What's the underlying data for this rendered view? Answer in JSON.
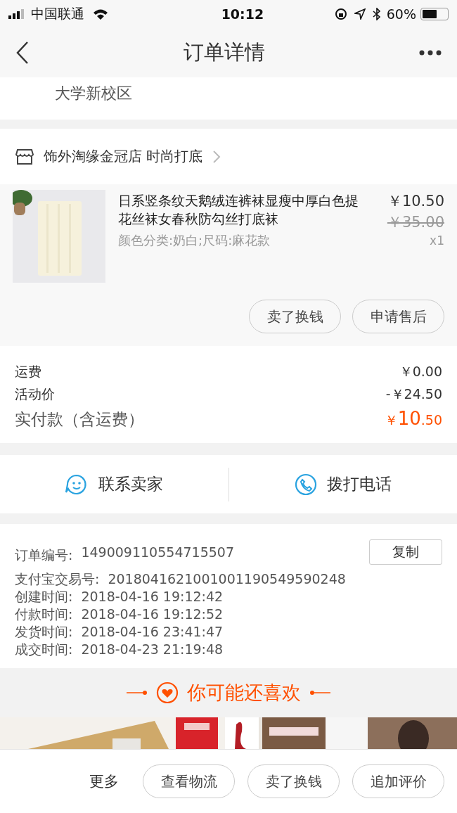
{
  "status_bar": {
    "carrier": "中国联通",
    "time": "10:12",
    "battery": "60%"
  },
  "nav": {
    "title": "订单详情"
  },
  "address": {
    "text": "大学新校区"
  },
  "shop": {
    "name": "饰外淘缘金冠店 时尚打底"
  },
  "product": {
    "title": "日系竖条纹天鹅绒连裤袜显瘦中厚白色提花丝袜女春秋防勾丝打底袜",
    "sku": "颜色分类:奶白;尺码:麻花款",
    "price": "￥10.50",
    "original_price": "￥35.00",
    "quantity": "x1",
    "actions": [
      "卖了换钱",
      "申请售后"
    ]
  },
  "fees": [
    {
      "label": "运费",
      "value": "￥0.00",
      "kind": "plain"
    },
    {
      "label": "活动价",
      "value": "-￥24.50",
      "kind": "plain"
    },
    {
      "label": "实付款（含运费）",
      "currency": "￥",
      "value": "10",
      "cents": ".50",
      "kind": "total"
    }
  ],
  "contact": [
    {
      "label": "联系卖家",
      "kind": "chat"
    },
    {
      "label": "拨打电话",
      "kind": "phone"
    }
  ],
  "order_info": [
    {
      "label": "订单编号:",
      "value": "149009110554715507",
      "copy": "复制"
    },
    {
      "label": "支付宝交易号:",
      "value": "2018041621001001190549590248"
    },
    {
      "label": "创建时间:",
      "value": "2018-04-16 19:12:42"
    },
    {
      "label": "付款时间:",
      "value": "2018-04-16 19:12:52"
    },
    {
      "label": "发货时间:",
      "value": "2018-04-16 23:41:47"
    },
    {
      "label": "成交时间:",
      "value": "2018-04-23 21:19:48"
    }
  ],
  "recommend": {
    "title": "你可能还喜欢"
  },
  "bottom_bar": {
    "more": "更多",
    "buttons": [
      "查看物流",
      "卖了换钱",
      "追加评价"
    ]
  }
}
